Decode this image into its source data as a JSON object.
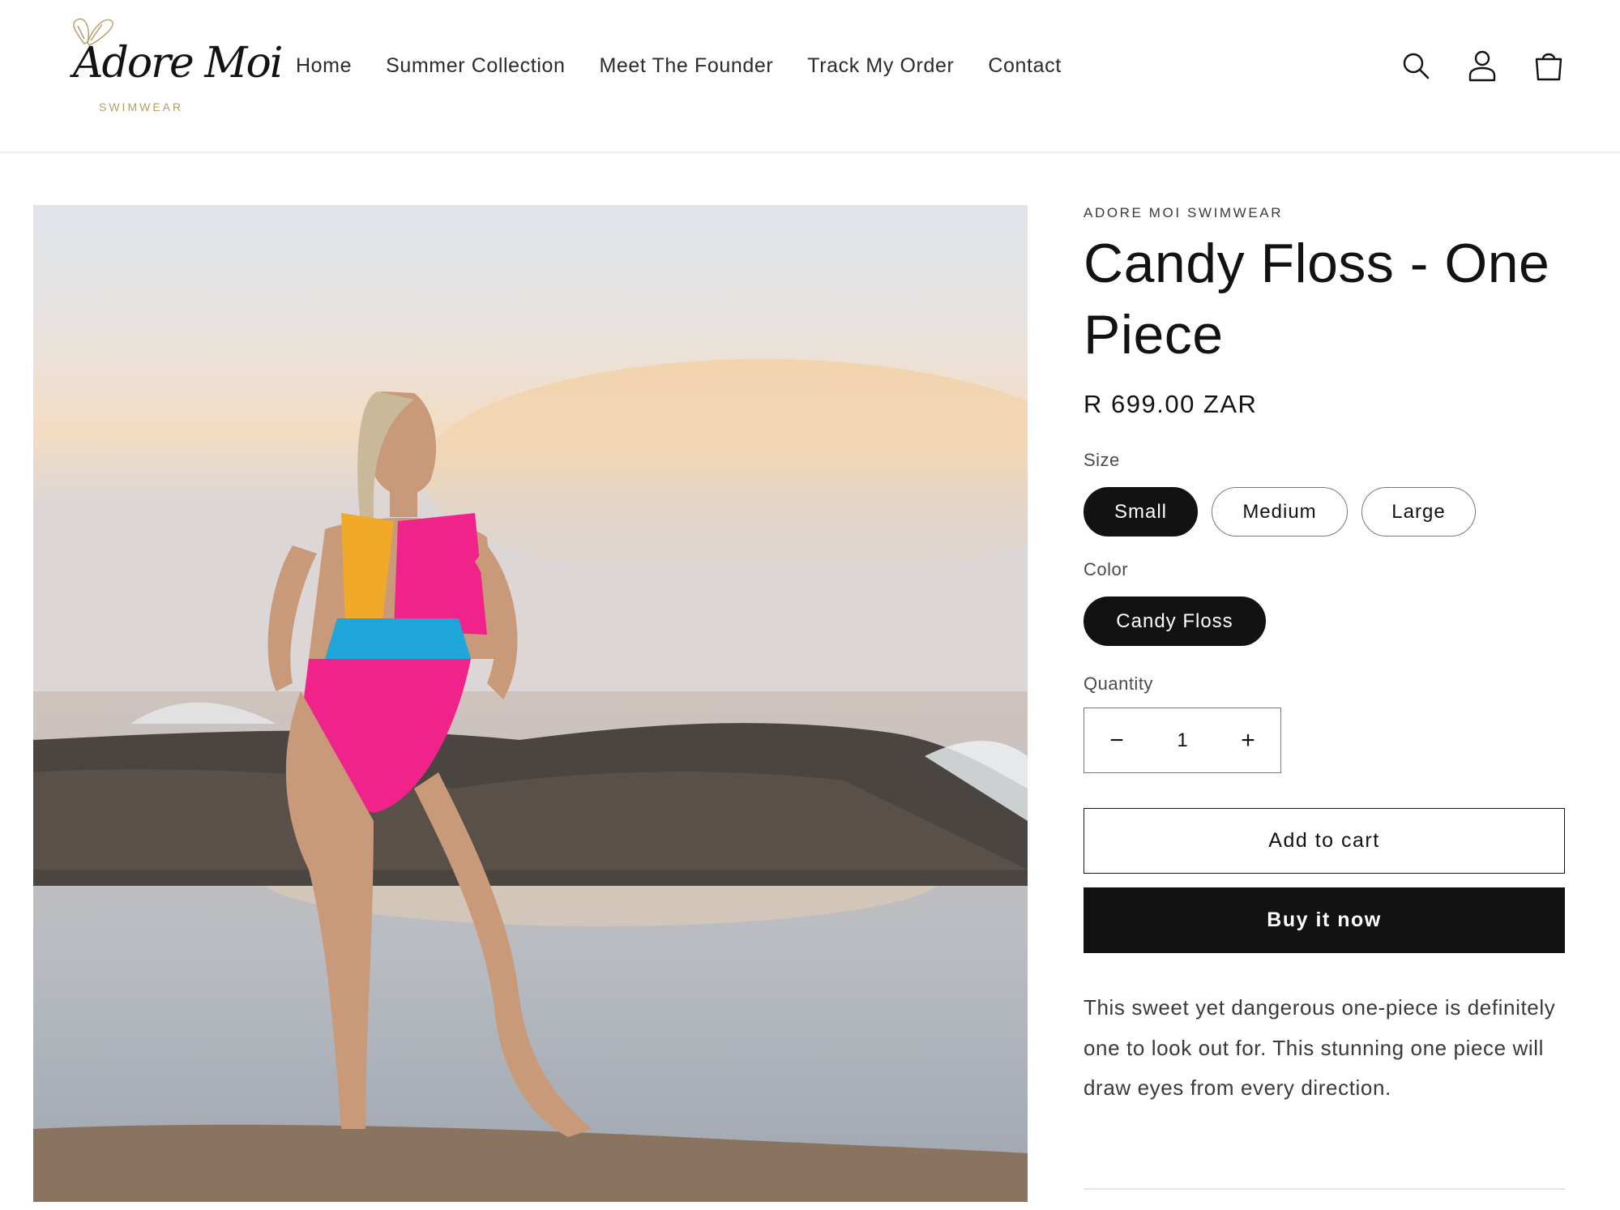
{
  "brand": {
    "logo_script": "Adore Moi",
    "logo_sub": "SWIMWEAR"
  },
  "nav": {
    "items": [
      "Home",
      "Summer Collection",
      "Meet The Founder",
      "Track My Order",
      "Contact"
    ]
  },
  "header_icons": [
    "search-icon",
    "account-icon",
    "cart-icon"
  ],
  "product": {
    "image_alt": "Model wearing Candy Floss one piece swimsuit on rocks by the sea at sunset",
    "vendor": "ADORE MOI SWIMWEAR",
    "title": "Candy Floss - One Piece",
    "price": "R 699.00 ZAR",
    "size_label": "Size",
    "sizes": [
      "Small",
      "Medium",
      "Large"
    ],
    "selected_size": "Small",
    "color_label": "Color",
    "colors": [
      "Candy Floss"
    ],
    "selected_color": "Candy Floss",
    "quantity_label": "Quantity",
    "quantity": "1",
    "decrease_symbol": "−",
    "increase_symbol": "+",
    "add_to_cart": "Add to cart",
    "buy_now": "Buy it now",
    "description": "This sweet yet dangerous one-piece is definitely one to look out for. This stunning one piece will draw eyes from every direction."
  },
  "colors": {
    "primary": "#121212",
    "text_muted": "#4b4b4b",
    "logo_gold": "#b79a62",
    "border": "#7a7a7a"
  }
}
